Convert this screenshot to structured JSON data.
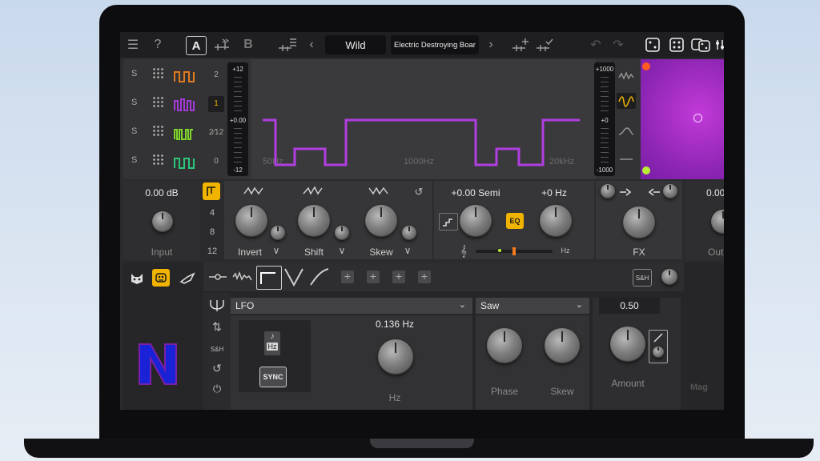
{
  "topbar": {
    "preset_bank": "Wild",
    "preset_name": "Electric Destroying Boar",
    "ab_a": "A",
    "ab_b": "B",
    "help": "?",
    "prev": "‹",
    "next": "›"
  },
  "oscillators": {
    "rows": [
      {
        "solo": "S",
        "octave": "2",
        "color": "#e07a1f"
      },
      {
        "solo": "S",
        "octave": "1",
        "color": "#a43ad8"
      },
      {
        "solo": "S",
        "octave": "2⁄12",
        "color": "#7fd62a"
      },
      {
        "solo": "S",
        "octave": "0",
        "color": "#2dc77a"
      }
    ],
    "pitch_slider": {
      "top": "+12",
      "mid": "+0.00",
      "bottom": "-12"
    },
    "freq_labels": [
      "50Hz",
      "1000Hz",
      "20kHz"
    ],
    "right_slider": {
      "top": "+1000",
      "mid": "+0",
      "bottom": "-1000"
    }
  },
  "input": {
    "value": "0.00 dB",
    "label": "Input"
  },
  "shaper": {
    "invert": "Invert",
    "shift": "Shift",
    "skew": "Skew",
    "counts": [
      "4",
      "8",
      "12"
    ]
  },
  "pitch": {
    "semi": "+0.00 Semi",
    "hz": "+0 Hz",
    "eq": "EQ",
    "hz_label": "Hz"
  },
  "fx": {
    "label": "FX"
  },
  "output": {
    "value": "0.00",
    "label": "Out"
  },
  "mod": {
    "source": "LFO",
    "shape": "Saw",
    "rate": "0.136 Hz",
    "rate_label": "Hz",
    "sync": "SYNC",
    "hz_badge": "Hz",
    "phase": "Phase",
    "skew": "Skew",
    "amount_value": "0.50",
    "amount": "Amount",
    "sh": "S&H",
    "sh_side": "S&H",
    "brand": "Mag"
  },
  "colors": {
    "accent": "#f0b400",
    "wave": "#b13ee0",
    "pad": "#8a24b2"
  }
}
